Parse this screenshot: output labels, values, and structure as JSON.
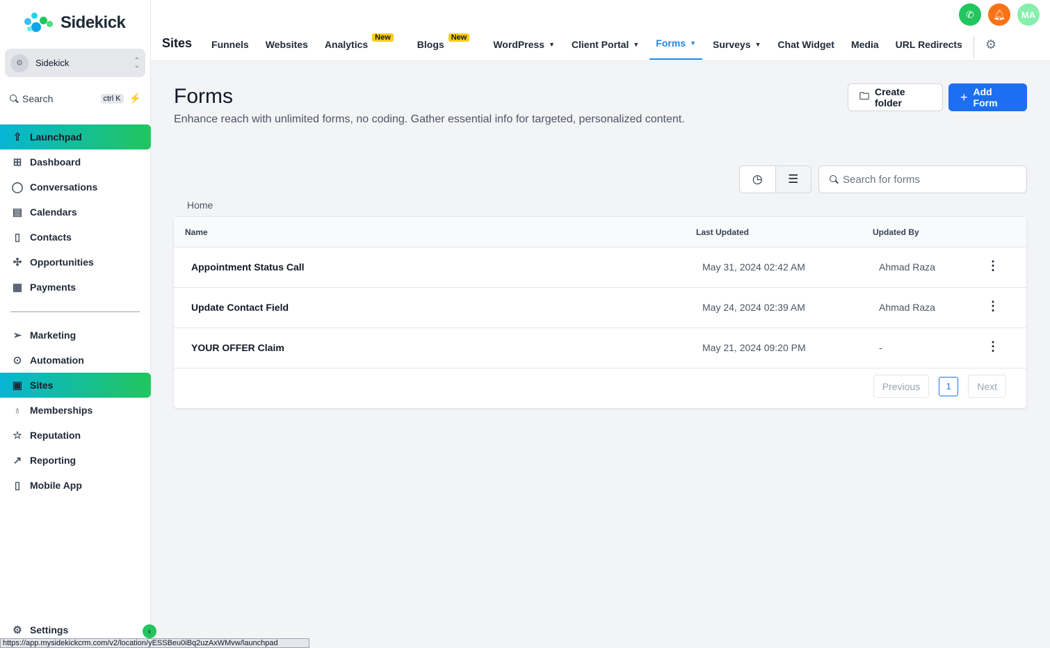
{
  "brand": {
    "name": "Sidekick",
    "colors": {
      "accent": "#1d6ff2",
      "gradient_start": "#06b6d4",
      "gradient_end": "#22c55e"
    }
  },
  "account": {
    "name": "Sidekick"
  },
  "search": {
    "label": "Search",
    "shortcut": "ctrl K"
  },
  "sidebar": {
    "items": [
      {
        "label": "Launchpad",
        "icon": "rocket-icon"
      },
      {
        "label": "Dashboard",
        "icon": "grid-icon"
      },
      {
        "label": "Conversations",
        "icon": "chat-icon"
      },
      {
        "label": "Calendars",
        "icon": "calendar-icon"
      },
      {
        "label": "Contacts",
        "icon": "contact-book-icon"
      },
      {
        "label": "Opportunities",
        "icon": "network-icon"
      },
      {
        "label": "Payments",
        "icon": "receipt-icon"
      }
    ],
    "items2": [
      {
        "label": "Marketing",
        "icon": "send-icon"
      },
      {
        "label": "Automation",
        "icon": "automation-icon"
      },
      {
        "label": "Sites",
        "icon": "browser-icon"
      },
      {
        "label": "Memberships",
        "icon": "award-icon"
      },
      {
        "label": "Reputation",
        "icon": "star-icon"
      },
      {
        "label": "Reporting",
        "icon": "trend-icon"
      },
      {
        "label": "Mobile App",
        "icon": "mobile-icon"
      }
    ],
    "settings": "Settings"
  },
  "status_url": "https://app.mysidekickcrm.com/v2/location/yESSBeu0iBq2uzAxWMvw/launchpad",
  "topbar": {
    "avatar_initials": "MA"
  },
  "subnav": {
    "title": "Sites",
    "tabs": [
      {
        "label": "Funnels"
      },
      {
        "label": "Websites"
      },
      {
        "label": "Analytics",
        "badge": "New"
      },
      {
        "label": "Blogs",
        "badge": "New"
      },
      {
        "label": "WordPress"
      },
      {
        "label": "Client Portal"
      },
      {
        "label": "Forms"
      },
      {
        "label": "Surveys"
      },
      {
        "label": "Chat Widget"
      },
      {
        "label": "Media"
      },
      {
        "label": "URL Redirects"
      }
    ]
  },
  "page": {
    "title": "Forms",
    "description": "Enhance reach with unlimited forms, no coding. Gather essential info for targeted, personalized content.",
    "create_folder": "Create folder",
    "add_form": "Add Form",
    "search_placeholder": "Search for forms",
    "breadcrumb": "Home"
  },
  "table": {
    "headers": {
      "name": "Name",
      "last_updated": "Last Updated",
      "updated_by": "Updated By"
    },
    "rows": [
      {
        "name": "Appointment Status Call",
        "last_updated": "May 31, 2024 02:42 AM",
        "updated_by": "Ahmad Raza"
      },
      {
        "name": "Update Contact Field",
        "last_updated": "May 24, 2024 02:39 AM",
        "updated_by": "Ahmad Raza"
      },
      {
        "name": "YOUR OFFER Claim",
        "last_updated": "May 21, 2024 09:20 PM",
        "updated_by": "-"
      }
    ]
  },
  "pagination": {
    "previous": "Previous",
    "page": "1",
    "next": "Next"
  }
}
